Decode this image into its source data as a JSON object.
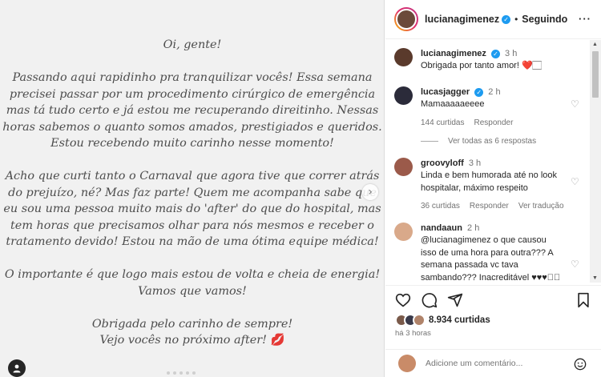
{
  "post": {
    "letter": {
      "greeting": "Oi, gente!",
      "paragraph1": [
        "Passando aqui rapidinho pra tranquilizar vocês! Essa semana",
        "precisei passar por um procedimento cirúrgico de emergência",
        "mas tá tudo certo e já estou me recuperando direitinho. Nessas",
        "horas sabemos o quanto somos amados, prestigiados e queridos.",
        "Estou recebendo muito carinho nesse momento!"
      ],
      "paragraph2": [
        "Acho que curti tanto o Carnaval que agora tive que correr atrás",
        "do prejuízo, né? Mas faz parte! Quem me acompanha sabe que",
        "eu sou uma pessoa muito mais do 'after' do que do hospital, mas",
        "tem horas que precisamos olhar para nós mesmos e receber o",
        "tratamento devido! Estou na mão de uma ótima equipe médica!"
      ],
      "paragraph3": [
        "O importante é que logo mais estou de volta e cheia de energia!",
        "Vamos que vamos!"
      ],
      "closing1": "Obrigada pelo carinho de sempre!",
      "closing2": "Vejo vocês no próximo after!",
      "kiss_emoji": "💋"
    },
    "next_icon": "chevron-right-icon",
    "tag_icon": "user-tag-icon"
  },
  "header": {
    "username": "lucianagimenez",
    "separator": "•",
    "follow_label": "Seguindo",
    "more_label": "···"
  },
  "comments": [
    {
      "username": "lucianagimenez",
      "verified": true,
      "time": "3 h",
      "text": "Obrigada por tanto amor! ❤️🏻",
      "avatar_color": "#5a3a2c"
    },
    {
      "username": "lucasjagger",
      "verified": true,
      "time": "2 h",
      "text": "Mamaaaaaeeee",
      "likes": "144 curtidas",
      "reply_label": "Responder",
      "view_replies": "Ver todas as 6 respostas",
      "avatar_color": "#2b2b3a"
    },
    {
      "username": "groovyloff",
      "verified": false,
      "time": "3 h",
      "text": "Linda e bem humorada até no look hospitalar, máximo respeito",
      "likes": "36 curtidas",
      "reply_label": "Responder",
      "translate_label": "Ver tradução",
      "avatar_color": "#9b5a4a"
    },
    {
      "username": "nandaaun",
      "verified": false,
      "time": "2 h",
      "text": "@lucianagimenez o que causou isso de uma hora para outra??? A semana passada vc tava sambando??? Inacreditável ♥♥♥🏻🏻",
      "avatar_color": "#d9a98a"
    }
  ],
  "actions": {
    "like_icon": "heart-icon",
    "comment_icon": "comment-icon",
    "share_icon": "send-icon",
    "save_icon": "bookmark-icon",
    "likes_count": "8.934 curtidas",
    "time_ago": "há 3 horas"
  },
  "add_comment": {
    "placeholder": "Adicione um comentário...",
    "emoji_icon": "smiley-icon"
  }
}
